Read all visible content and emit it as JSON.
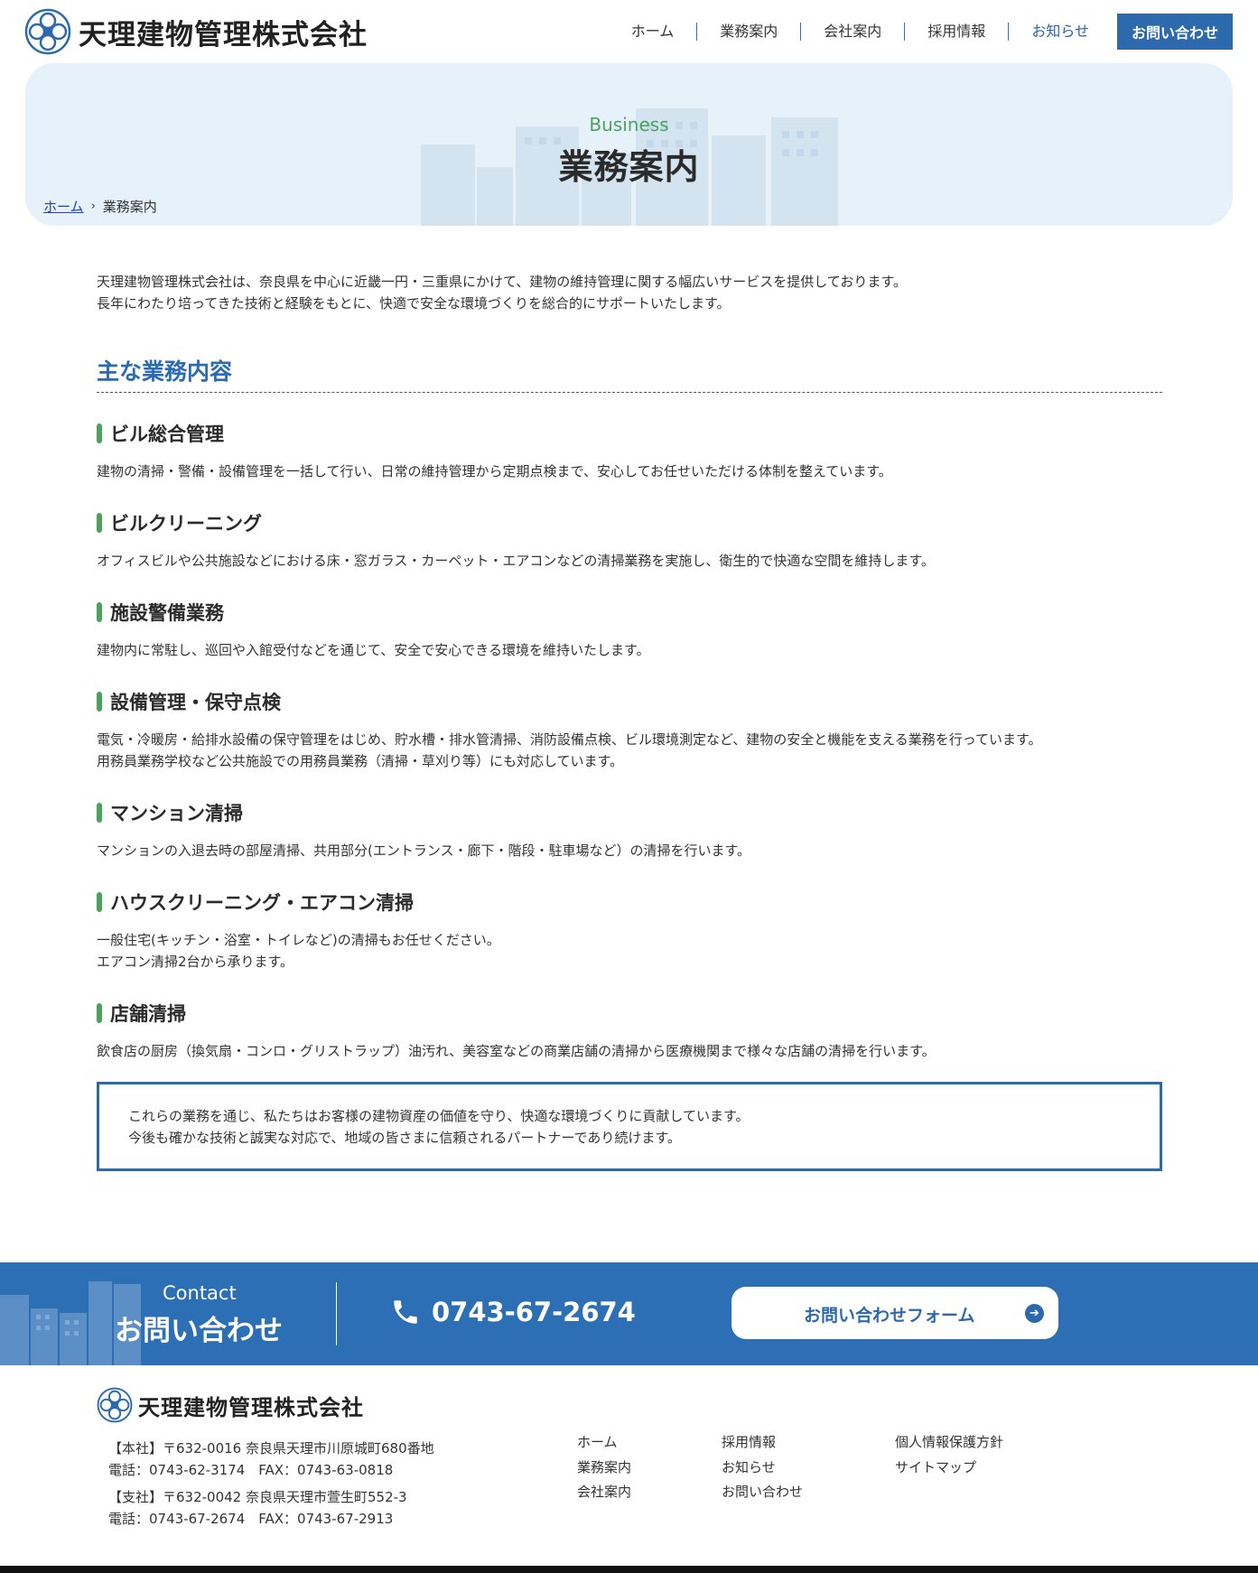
{
  "header": {
    "logo_text": "天理建物管理株式会社",
    "nav": [
      "ホーム",
      "業務案内",
      "会社案内",
      "採用情報",
      "お知らせ"
    ],
    "contact_button": "お問い合わせ"
  },
  "hero": {
    "subtitle": "Business",
    "title": "業務案内",
    "breadcrumb_home": "ホーム",
    "breadcrumb_sep": "›",
    "breadcrumb_current": "業務案内"
  },
  "intro": [
    "天理建物管理株式会社は、奈良県を中心に近畿一円・三重県にかけて、建物の維持管理に関する幅広いサービスを提供しております。",
    "長年にわたり培ってきた技術と経験をもとに、快適で安全な環境づくりを総合的にサポートいたします。"
  ],
  "section_title": "主な業務内容",
  "services": [
    {
      "title": "ビル総合管理",
      "lines": [
        "建物の清掃・警備・設備管理を一括して行い、日常の維持管理から定期点検まで、安心してお任せいただける体制を整えています。"
      ]
    },
    {
      "title": "ビルクリーニング",
      "lines": [
        "オフィスビルや公共施設などにおける床・窓ガラス・カーペット・エアコンなどの清掃業務を実施し、衛生的で快適な空間を維持します。"
      ]
    },
    {
      "title": "施設警備業務",
      "lines": [
        "建物内に常駐し、巡回や入館受付などを通じて、安全で安心できる環境を維持いたします。"
      ]
    },
    {
      "title": "設備管理・保守点検",
      "lines": [
        "電気・冷暖房・給排水設備の保守管理をはじめ、貯水槽・排水管清掃、消防設備点検、ビル環境測定など、建物の安全と機能を支える業務を行っています。",
        "用務員業務学校など公共施設での用務員業務（清掃・草刈り等）にも対応しています。"
      ]
    },
    {
      "title": "マンション清掃",
      "lines": [
        "マンションの入退去時の部屋清掃、共用部分(エントランス・廊下・階段・駐車場など）の清掃を行います。"
      ]
    },
    {
      "title": "ハウスクリーニング・エアコン清掃",
      "lines": [
        "一般住宅(キッチン・浴室・トイレなど)の清掃もお任せください。",
        "エアコン清掃2台から承ります。"
      ]
    },
    {
      "title": "店舗清掃",
      "lines": [
        "飲食店の厨房（換気扇・コンロ・グリストラップ）油汚れ、美容室などの商業店舗の清掃から医療機関まで様々な店舗の清掃を行います。"
      ]
    }
  ],
  "summary": [
    "これらの業務を通じ、私たちはお客様の建物資産の価値を守り、快適な環境づくりに貢献しています。",
    "今後も確かな技術と誠実な対応で、地域の皆さまに信頼されるパートナーであり続けます。"
  ],
  "contact": {
    "en": "Contact",
    "ja": "お問い合わせ",
    "phone": "0743-67-2674",
    "form_button": "お問い合わせフォーム"
  },
  "footer": {
    "logo_text": "天理建物管理株式会社",
    "head_office": "【本社】〒632-0016 奈良県天理市川原城町680番地",
    "head_office_tel": "電話：0743-62-3174　FAX：0743-63-0818",
    "branch": "【支社】〒632-0042 奈良県天理市萱生町552-3",
    "branch_tel": "電話：0743-67-2674　FAX：0743-67-2913",
    "nav_col1": [
      "ホーム",
      "業務案内",
      "会社案内"
    ],
    "nav_col2": [
      "採用情報",
      "お知らせ",
      "お問い合わせ"
    ],
    "nav_col3": [
      "個人情報保護方針",
      "サイトマップ"
    ]
  },
  "colors": {
    "brand_blue": "#2c6aad",
    "accent_green": "#4aa35a",
    "hero_bg": "#e6f1fa"
  },
  "icons": [
    "logo-mark-icon",
    "phone-icon",
    "arrow-right-icon"
  ]
}
